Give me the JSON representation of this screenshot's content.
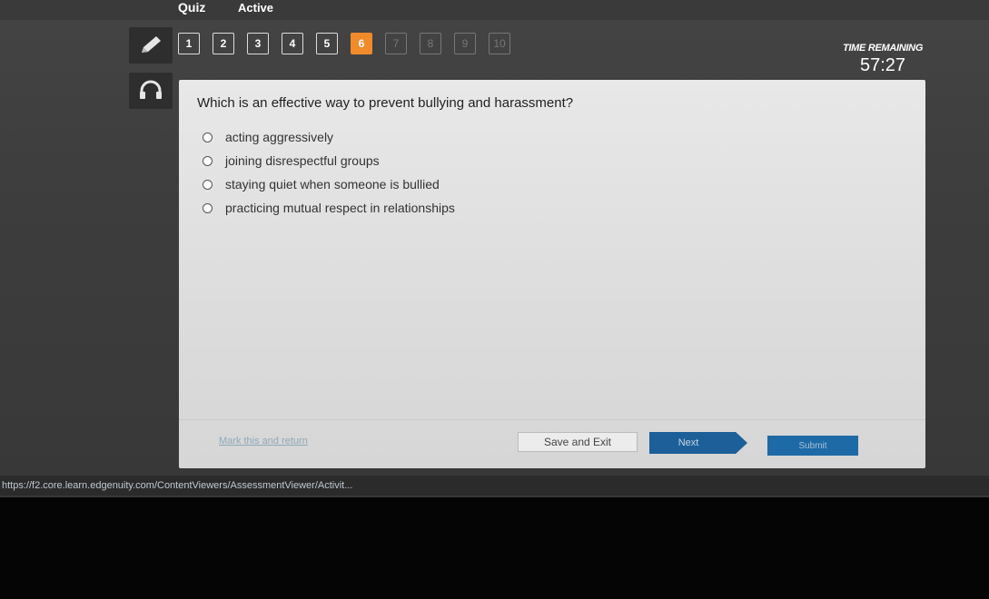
{
  "header": {
    "quiz_label": "Quiz",
    "status": "Active"
  },
  "tools": [
    {
      "icon": "pencil-icon"
    },
    {
      "icon": "headphones-icon"
    }
  ],
  "question_nav": {
    "items": [
      "1",
      "2",
      "3",
      "4",
      "5",
      "6",
      "7",
      "8",
      "9",
      "10"
    ],
    "current": "6",
    "accent_color": "#f08a2b"
  },
  "timer": {
    "label": "TIME REMAINING",
    "value": "57:27"
  },
  "question": {
    "text": "Which is an effective way to prevent bullying and harassment?",
    "options": [
      "acting aggressively",
      "joining disrespectful groups",
      "staying quiet when someone is bullied",
      "practicing mutual respect in relationships"
    ]
  },
  "footer": {
    "mark_link": "Mark this and return",
    "save_label": "Save and Exit",
    "next_label": "Next",
    "submit_label": "Submit"
  },
  "status_bar": {
    "url": "https://f2.core.learn.edgenuity.com/ContentViewers/AssessmentViewer/Activit..."
  }
}
